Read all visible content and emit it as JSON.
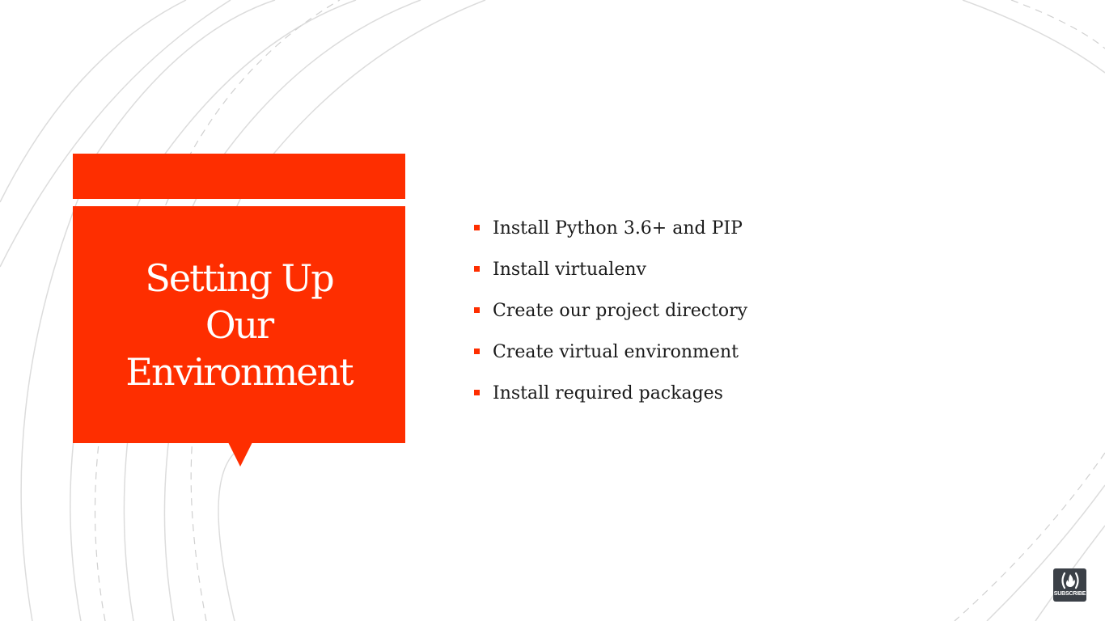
{
  "slide": {
    "title": "Setting Up\nOur\nEnvironment",
    "accent_color": "#fe2e00",
    "bullets": [
      {
        "text": "Install Python 3.6+ and PIP"
      },
      {
        "text": "Install virtualenv"
      },
      {
        "text": "Create our project directory"
      },
      {
        "text": "Create virtual environment"
      },
      {
        "text": "Install required packages"
      }
    ]
  },
  "subscribe_badge": {
    "label": "SUBSCRIBE",
    "icon": "fire-brackets-icon"
  }
}
